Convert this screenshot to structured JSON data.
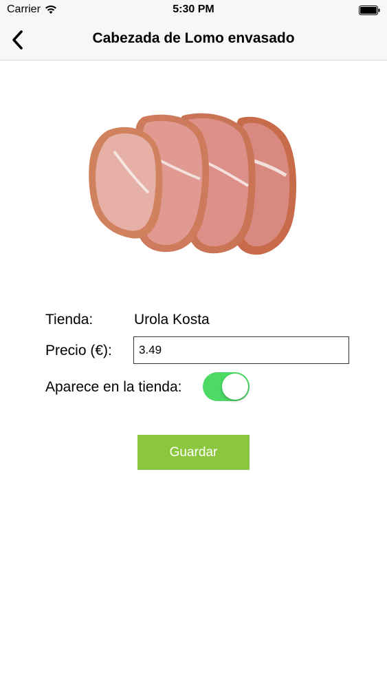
{
  "status_bar": {
    "carrier": "Carrier",
    "time": "5:30 PM",
    "icons": [
      "wifi-icon",
      "battery-icon"
    ]
  },
  "nav": {
    "title": "Cabezada de Lomo envasado",
    "back_icon": "chevron-left-icon"
  },
  "product": {
    "image": "sliced-cured-pork-loin"
  },
  "form": {
    "tienda_label": "Tienda:",
    "tienda_value": "Urola Kosta",
    "precio_label": "Precio (€):",
    "precio_value": "3.49",
    "aparece_label": "Aparece en la tienda:",
    "aparece_on": true
  },
  "actions": {
    "save_label": "Guardar"
  },
  "colors": {
    "toggle_on": "#4cd964",
    "button_bg": "#8cc63f",
    "bar_bg": "#f7f7f7"
  }
}
